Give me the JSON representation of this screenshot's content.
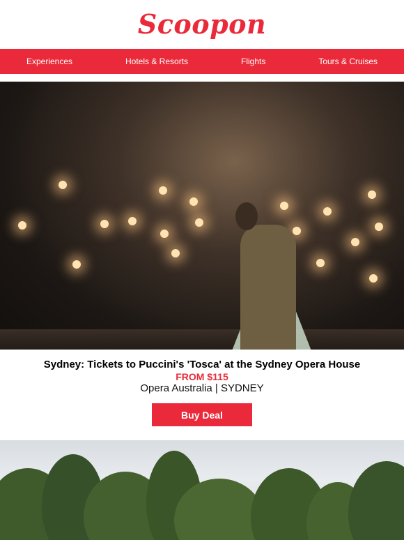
{
  "brand": {
    "logo_text": "Scoopon",
    "accent_color": "#ea2a3a"
  },
  "nav": {
    "items": [
      {
        "label": "Experiences"
      },
      {
        "label": "Hotels & Resorts"
      },
      {
        "label": "Flights"
      },
      {
        "label": "Tours & Cruises"
      }
    ]
  },
  "deal": {
    "title": "Sydney: Tickets to Puccini's 'Tosca' at the Sydney Opera House",
    "price": "FROM $115",
    "meta": "Opera Australia | SYDNEY",
    "button_label": "Buy Deal"
  }
}
